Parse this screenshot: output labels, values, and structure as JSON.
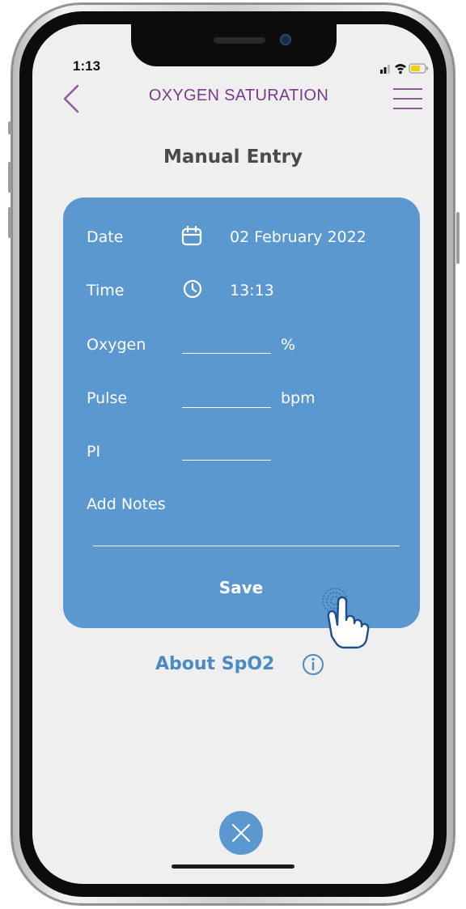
{
  "status_bar": {
    "time": "1:13"
  },
  "header": {
    "title": "OXYGEN SATURATION",
    "back_icon": "chevron-left-icon",
    "menu_icon": "hamburger-menu-icon"
  },
  "subtitle": "Manual Entry",
  "form": {
    "date": {
      "label": "Date",
      "icon": "calendar-icon",
      "value": "02 February 2022"
    },
    "time": {
      "label": "Time",
      "icon": "clock-icon",
      "value": "13:13"
    },
    "oxygen": {
      "label": "Oxygen",
      "value": "",
      "unit": "%"
    },
    "pulse": {
      "label": "Pulse",
      "value": "",
      "unit": "bpm"
    },
    "pi": {
      "label": "PI",
      "value": ""
    },
    "notes": {
      "label": "Add Notes",
      "value": ""
    },
    "save_label": "Save"
  },
  "about": {
    "label": "About SpO2",
    "icon": "info-icon"
  },
  "close_icon": "close-icon",
  "colors": {
    "title": "#7b3a8c",
    "card": "#5b98d0",
    "about": "#4c8ac4",
    "screen_bg": "#efefef"
  }
}
